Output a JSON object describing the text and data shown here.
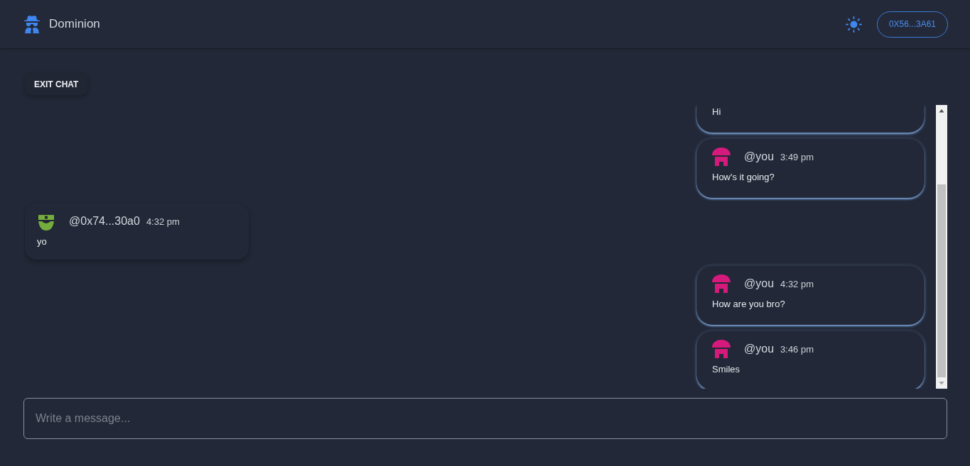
{
  "header": {
    "app_name": "Dominion",
    "account_button": "0X56...3A61"
  },
  "exit_button": "EXIT CHAT",
  "messages": [
    {
      "kind": "sent",
      "clipped": true,
      "text": "Hi"
    },
    {
      "kind": "sent",
      "clipped": false,
      "author": "@you",
      "time": "3:49 pm",
      "text": "How's it going?",
      "color": "#d61a7c"
    },
    {
      "kind": "received",
      "clipped": false,
      "author": "@0x74...30a0",
      "time": "4:32 pm",
      "text": "yo",
      "color": "#74ad3c"
    },
    {
      "kind": "sent",
      "clipped": false,
      "author": "@you",
      "time": "4:32 pm",
      "text": "How are you bro?",
      "color": "#d61a7c"
    },
    {
      "kind": "sent",
      "clipped": false,
      "author": "@you",
      "time": "3:46 pm",
      "text": "Smiles",
      "color": "#d61a7c"
    }
  ],
  "composer": {
    "placeholder": "Write a message..."
  }
}
